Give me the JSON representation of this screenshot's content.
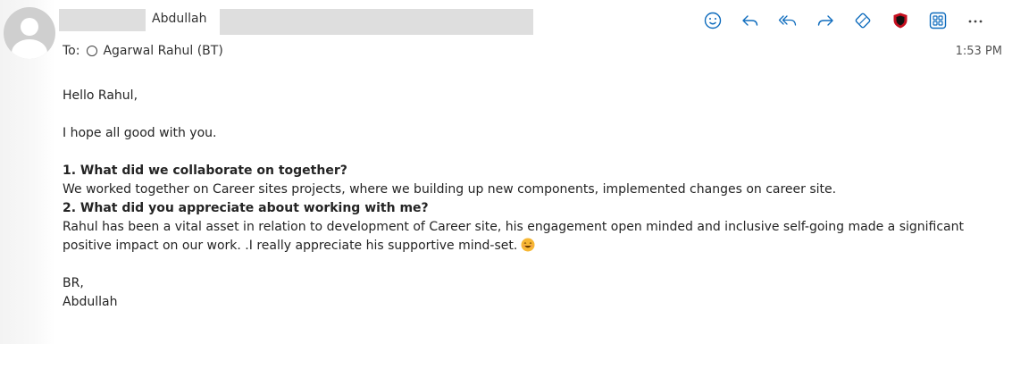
{
  "sender": {
    "name": "Abdullah"
  },
  "recipient": {
    "prefix": "To:",
    "name": "Agarwal Rahul (BT)"
  },
  "time": "1:53 PM",
  "toolbar": {
    "icons": [
      "emoji-icon",
      "reply-icon",
      "reply-all-icon",
      "forward-icon",
      "tag-icon",
      "shield-icon",
      "apps-icon",
      "more-icon"
    ],
    "colors": {
      "accent": "#0f6cbd",
      "shield": "#c50f1f"
    }
  },
  "email": {
    "greeting": "Hello Rahul,",
    "opening": "I hope all good with you.",
    "q1": "1. What did we collaborate on together?",
    "a1": "We worked together on Career sites projects, where we building up new components, implemented changes on career site.",
    "q2": "2. What did you appreciate about working with me?",
    "a2": "Rahul has been a vital asset in relation to development of Career site, his engagement open minded and inclusive self-going made a significant positive impact on our work. .I really appreciate his supportive mind-set.",
    "signoff": "BR,",
    "signature": "Abdullah"
  }
}
